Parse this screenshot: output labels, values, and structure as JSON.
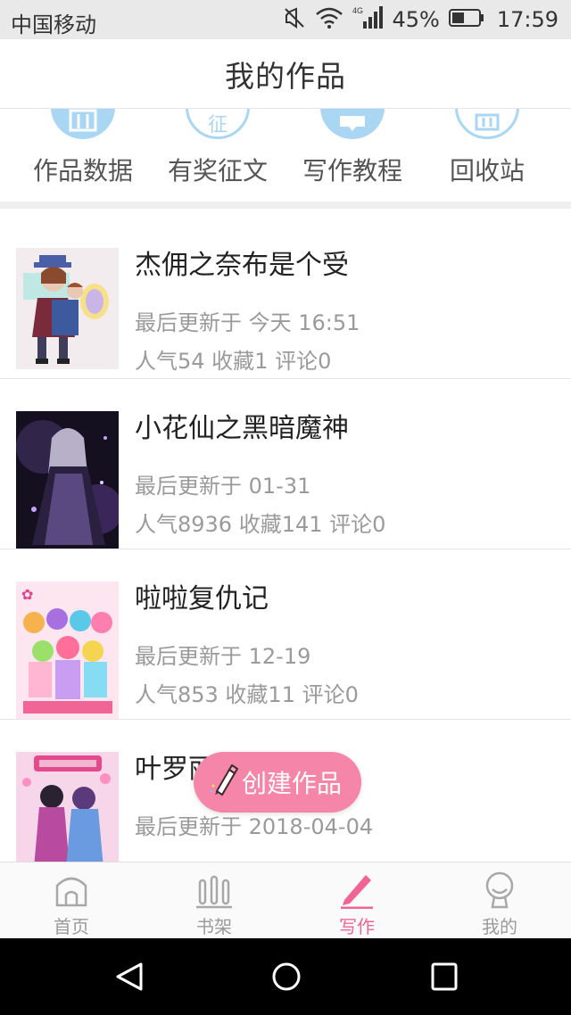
{
  "status_bar": {
    "carrier": "中国移动",
    "network": "4G",
    "battery_percent": "45%",
    "time": "17:59",
    "icons": [
      "mute-icon",
      "wifi-icon",
      "signal-icon",
      "battery-icon"
    ]
  },
  "header": {
    "title": "我的作品"
  },
  "quick_actions": [
    {
      "label": "作品数据",
      "icon": "chart-icon"
    },
    {
      "label": "有奖征文",
      "icon": "contest-icon"
    },
    {
      "label": "写作教程",
      "icon": "tutorial-icon"
    },
    {
      "label": "回收站",
      "icon": "recycle-bin-icon"
    }
  ],
  "works": [
    {
      "title": "杰佣之奈布是个受",
      "updated": "最后更新于 今天 16:51",
      "stats": "人气54 收藏1 评论0"
    },
    {
      "title": "小花仙之黑暗魔神",
      "updated": "最后更新于 01-31",
      "stats": "人气8936 收藏141 评论0"
    },
    {
      "title": "啦啦复仇记",
      "updated": "最后更新于 12-19",
      "stats": "人气853 收藏11 评论0"
    },
    {
      "title": "叶罗丽之舞玲珑",
      "updated": "最后更新于 2018-04-04",
      "stats": ""
    }
  ],
  "fab": {
    "label": "创建作品",
    "icon": "pencil-icon"
  },
  "tabbar": [
    {
      "label": "首页",
      "icon": "home-icon",
      "active": false
    },
    {
      "label": "书架",
      "icon": "bookshelf-icon",
      "active": false
    },
    {
      "label": "写作",
      "icon": "pen-icon",
      "active": true
    },
    {
      "label": "我的",
      "icon": "profile-icon",
      "active": false
    }
  ],
  "colors": {
    "accent": "#f06595",
    "fab": "#f585a9",
    "quick_icon": "#a9d6f3",
    "meta_text": "#9a9a9a"
  }
}
